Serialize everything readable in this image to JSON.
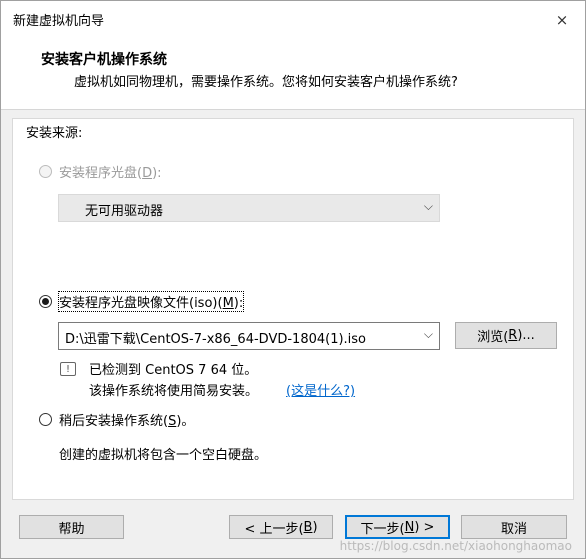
{
  "window": {
    "title": "新建虚拟机向导",
    "close_icon": "×"
  },
  "header": {
    "title": "安装客户机操作系统",
    "subtitle": "虚拟机如同物理机，需要操作系统。您将如何安装客户机操作系统?"
  },
  "source": {
    "label": "安装来源:",
    "disc": {
      "label_pre": "安装程序光盘(",
      "mnemonic": "D",
      "label_post": "):",
      "enabled": false,
      "checked": false
    },
    "disc_combo": {
      "value": "无可用驱动器"
    },
    "iso": {
      "label_pre": "安装程序光盘映像文件(iso)(",
      "mnemonic": "M",
      "label_post": "):",
      "enabled": true,
      "checked": true
    },
    "iso_combo": {
      "value": "D:\\迅雷下载\\CentOS-7-x86_64-DVD-1804(1).iso"
    },
    "browse": {
      "label_pre": "浏览(",
      "mnemonic": "R",
      "label_post": ")..."
    },
    "detect_line1": "已检测到 CentOS 7 64 位。",
    "detect_line2": "该操作系统将使用简易安装。",
    "detect_link": "(这是什么?)",
    "later": {
      "label_pre": "稍后安装操作系统(",
      "mnemonic": "S",
      "label_post": ")。",
      "checked": false
    },
    "later_note": "创建的虚拟机将包含一个空白硬盘。"
  },
  "buttons": {
    "help": "帮助",
    "back": {
      "pre": "< 上一步(",
      "mnemonic": "B",
      "post": ")"
    },
    "next": {
      "pre": "下一步(",
      "mnemonic": "N",
      "post": ") >"
    },
    "cancel": "取消"
  },
  "watermark": "https://blog.csdn.net/xiaohonghaomao"
}
